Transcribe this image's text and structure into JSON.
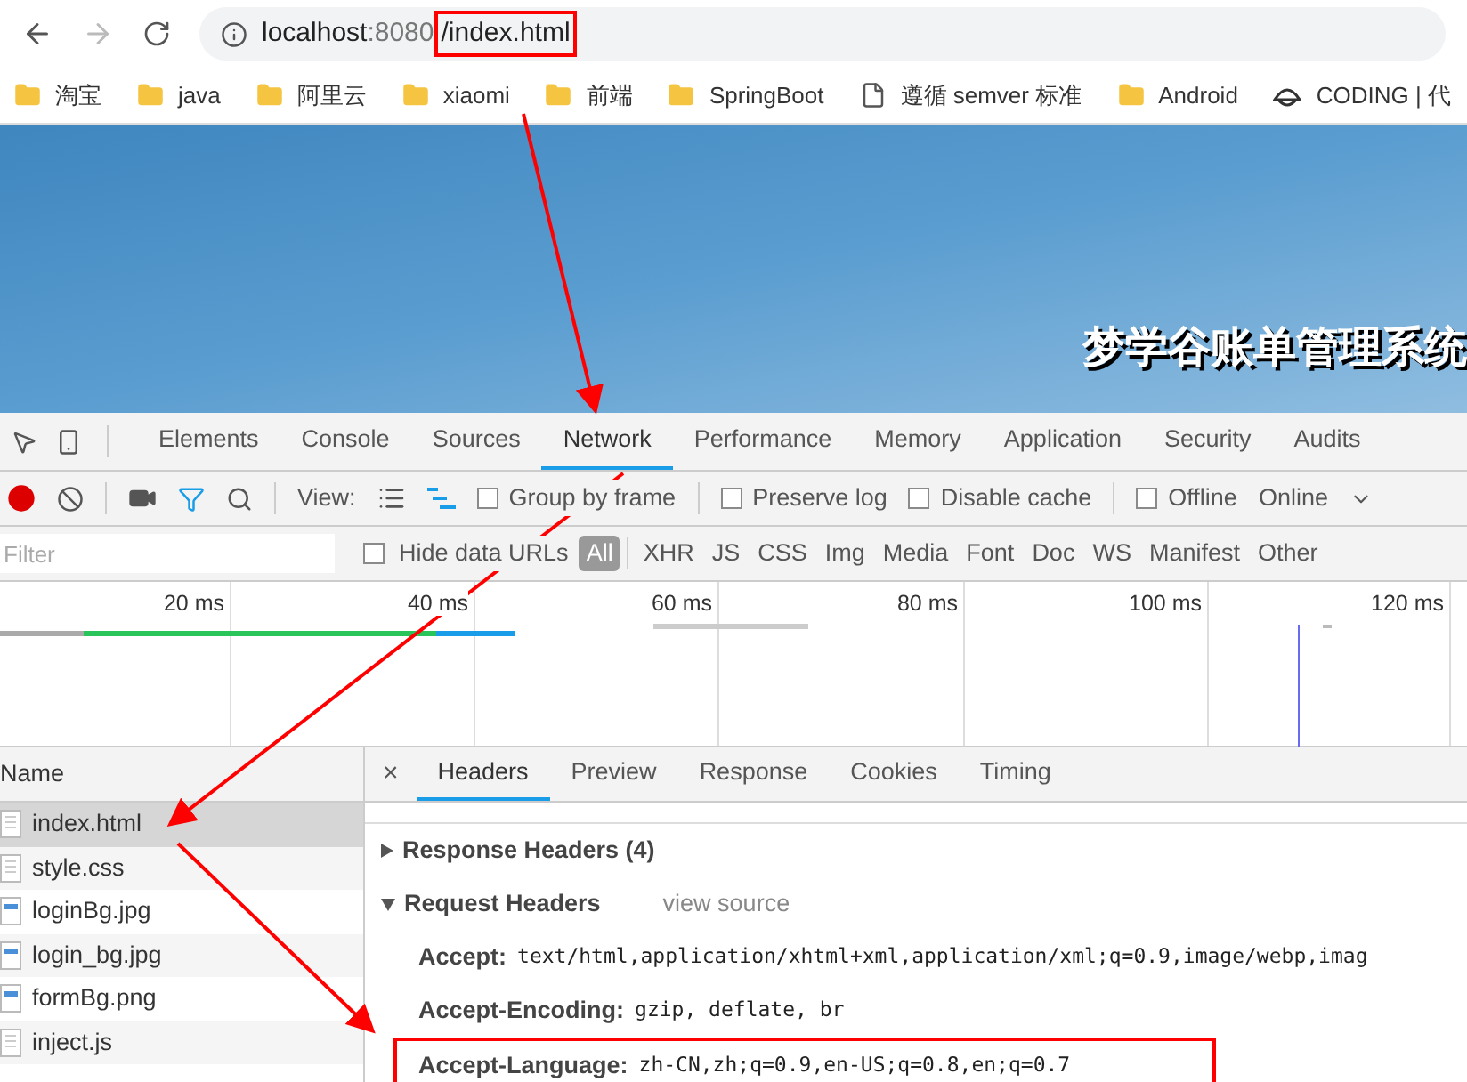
{
  "browser": {
    "url": {
      "host": "localhost",
      "port": ":8080",
      "path": "/index.html",
      "path_highlighted": true
    },
    "bookmarks": [
      {
        "label": "淘宝",
        "kind": "folder"
      },
      {
        "label": "java",
        "kind": "folder"
      },
      {
        "label": "阿里云",
        "kind": "folder"
      },
      {
        "label": "xiaomi",
        "kind": "folder"
      },
      {
        "label": "前端",
        "kind": "folder"
      },
      {
        "label": "SpringBoot",
        "kind": "folder"
      },
      {
        "label": "遵循 semver 标准",
        "kind": "page"
      },
      {
        "label": "Android",
        "kind": "folder"
      },
      {
        "label": "CODING | 代",
        "kind": "logo"
      }
    ]
  },
  "page": {
    "title": "梦学谷账单管理系统"
  },
  "devtools": {
    "tabs": [
      {
        "label": "Elements",
        "selected": false
      },
      {
        "label": "Console",
        "selected": false
      },
      {
        "label": "Sources",
        "selected": false
      },
      {
        "label": "Network",
        "selected": true
      },
      {
        "label": "Performance",
        "selected": false
      },
      {
        "label": "Memory",
        "selected": false
      },
      {
        "label": "Application",
        "selected": false
      },
      {
        "label": "Security",
        "selected": false
      },
      {
        "label": "Audits",
        "selected": false
      }
    ],
    "toolbar": {
      "recording": true,
      "view_label": "View:",
      "checkboxes": [
        {
          "label": "Group by frame",
          "checked": false
        },
        {
          "label": "Preserve log",
          "checked": false
        },
        {
          "label": "Disable cache",
          "checked": false
        },
        {
          "label": "Offline",
          "checked": false
        }
      ],
      "throttle": "Online"
    },
    "filter": {
      "placeholder": "Filter",
      "hide_data_urls": {
        "label": "Hide data URLs",
        "checked": false
      },
      "types": [
        {
          "label": "All",
          "selected": true
        },
        {
          "label": "XHR",
          "selected": false
        },
        {
          "label": "JS",
          "selected": false
        },
        {
          "label": "CSS",
          "selected": false
        },
        {
          "label": "Img",
          "selected": false
        },
        {
          "label": "Media",
          "selected": false
        },
        {
          "label": "Font",
          "selected": false
        },
        {
          "label": "Doc",
          "selected": false
        },
        {
          "label": "WS",
          "selected": false
        },
        {
          "label": "Manifest",
          "selected": false
        },
        {
          "label": "Other",
          "selected": false
        }
      ]
    },
    "timeline": {
      "ticks": [
        "20 ms",
        "40 ms",
        "60 ms",
        "80 ms",
        "100 ms",
        "120 ms"
      ]
    },
    "requests": {
      "header": "Name",
      "rows": [
        {
          "name": "index.html",
          "kind": "document",
          "selected": true
        },
        {
          "name": "style.css",
          "kind": "document",
          "selected": false
        },
        {
          "name": "loginBg.jpg",
          "kind": "image",
          "selected": false
        },
        {
          "name": "login_bg.jpg",
          "kind": "image",
          "selected": false
        },
        {
          "name": "formBg.png",
          "kind": "image",
          "selected": false
        },
        {
          "name": "inject.js",
          "kind": "document",
          "selected": false
        }
      ]
    },
    "details": {
      "close": "×",
      "tabs": [
        {
          "label": "Headers",
          "selected": true
        },
        {
          "label": "Preview",
          "selected": false
        },
        {
          "label": "Response",
          "selected": false
        },
        {
          "label": "Cookies",
          "selected": false
        },
        {
          "label": "Timing",
          "selected": false
        }
      ],
      "sections": [
        {
          "title": "Response Headers (4)",
          "expanded": false
        },
        {
          "title": "Request Headers",
          "expanded": true,
          "link": "view source"
        }
      ],
      "headers": [
        {
          "key": "Accept:",
          "value": "text/html,application/xhtml+xml,application/xml;q=0.9,image/webp,imag",
          "highlighted": false
        },
        {
          "key": "Accept-Encoding:",
          "value": "gzip, deflate, br",
          "highlighted": false
        },
        {
          "key": "Accept-Language:",
          "value": "zh-CN,zh;q=0.9,en-US;q=0.8,en;q=0.7",
          "highlighted": true
        }
      ]
    }
  }
}
